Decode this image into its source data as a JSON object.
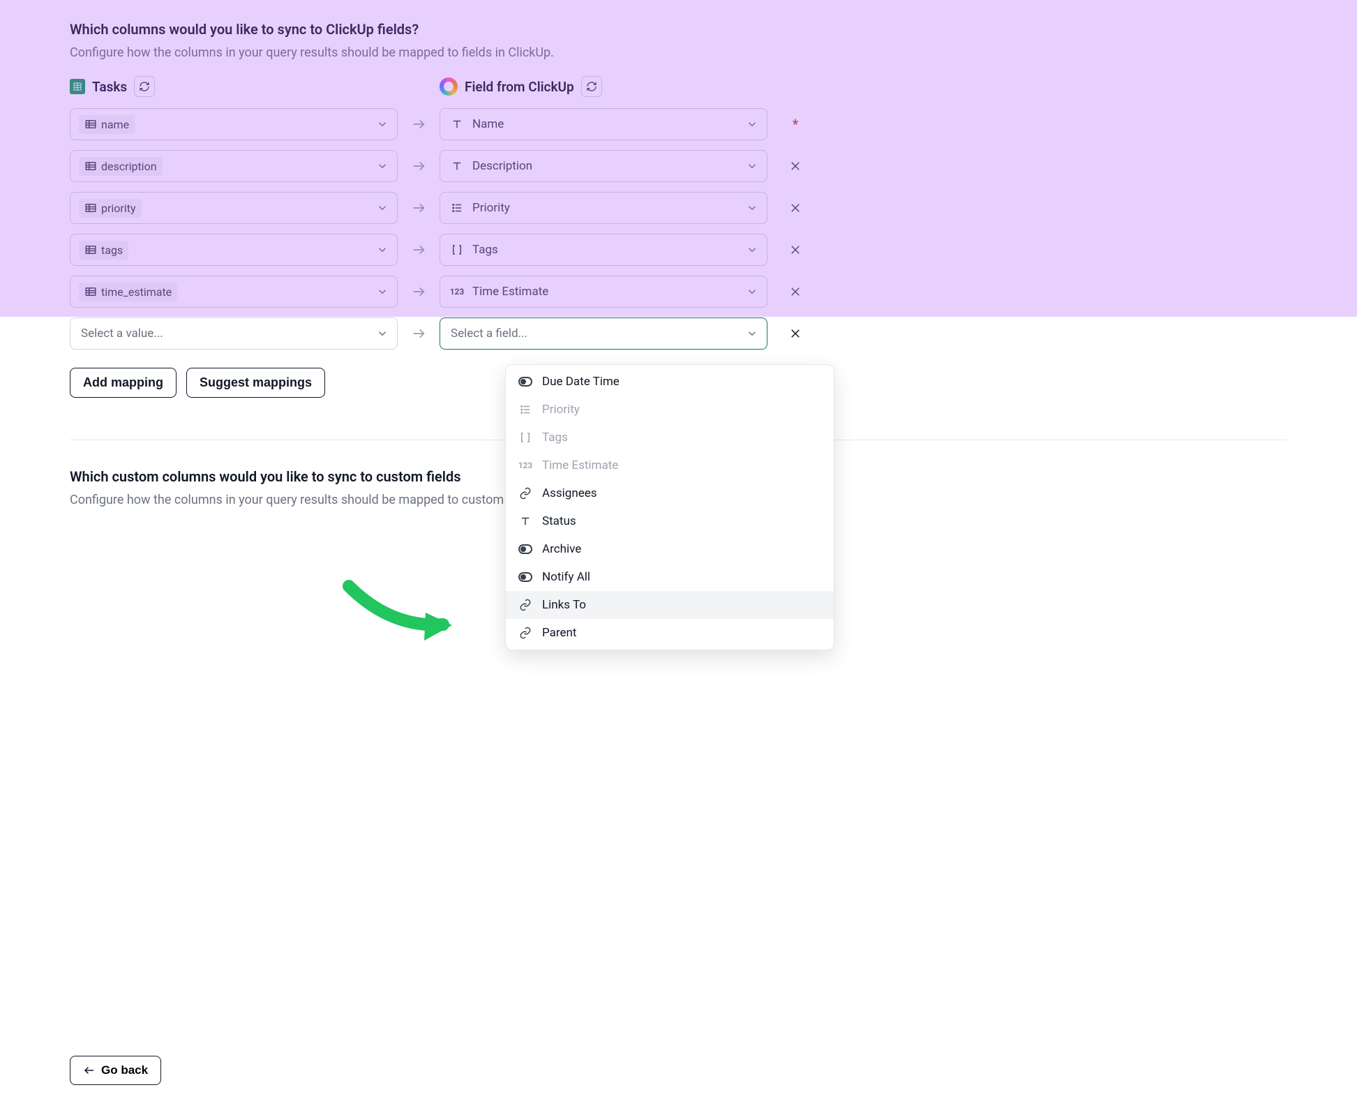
{
  "section1": {
    "title": "Which columns would you like to sync to ClickUp fields?",
    "subtitle": "Configure how the columns in your query results should be mapped to fields in ClickUp.",
    "left_header": "Tasks",
    "right_header": "Field from ClickUp"
  },
  "mappings": [
    {
      "source": "name",
      "target": "Name",
      "target_icon": "text",
      "required": true
    },
    {
      "source": "description",
      "target": "Description",
      "target_icon": "text",
      "required": false
    },
    {
      "source": "priority",
      "target": "Priority",
      "target_icon": "list",
      "required": false
    },
    {
      "source": "tags",
      "target": "Tags",
      "target_icon": "brackets",
      "required": false
    },
    {
      "source": "time_estimate",
      "target": "Time Estimate",
      "target_icon": "123",
      "required": false
    }
  ],
  "new_row": {
    "source_placeholder": "Select a value...",
    "target_placeholder": "Select a field..."
  },
  "buttons": {
    "add_mapping": "Add mapping",
    "suggest": "Suggest mappings",
    "go_back": "Go back"
  },
  "section2": {
    "title": "Which custom columns would you like to sync to custom fields",
    "subtitle": "Configure how the columns in your query results should be mapped to custom fields in ClickUp."
  },
  "dropdown": {
    "items": [
      {
        "label": "Due Date Time",
        "icon": "toggle",
        "disabled": false
      },
      {
        "label": "Priority",
        "icon": "list",
        "disabled": true
      },
      {
        "label": "Tags",
        "icon": "brackets",
        "disabled": true
      },
      {
        "label": "Time Estimate",
        "icon": "123",
        "disabled": true
      },
      {
        "label": "Assignees",
        "icon": "link",
        "disabled": false
      },
      {
        "label": "Status",
        "icon": "text",
        "disabled": false
      },
      {
        "label": "Archive",
        "icon": "toggle",
        "disabled": false
      },
      {
        "label": "Notify All",
        "icon": "toggle",
        "disabled": false
      },
      {
        "label": "Links To",
        "icon": "link",
        "disabled": false,
        "highlight": true
      },
      {
        "label": "Parent",
        "icon": "link",
        "disabled": false
      }
    ]
  }
}
